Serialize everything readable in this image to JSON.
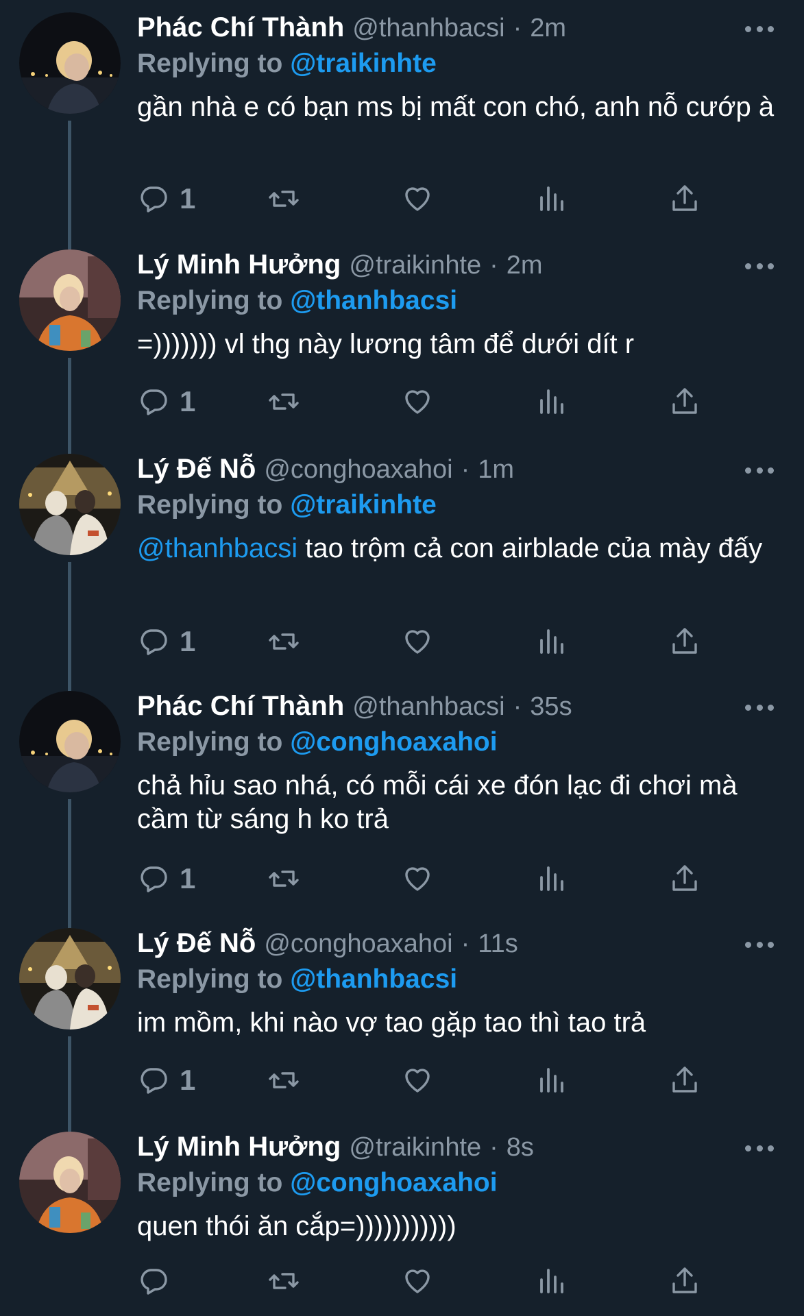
{
  "tweets": [
    {
      "name": "Phác Chí Thành",
      "handle": "@thanhbacsi",
      "time": "2m",
      "replying_prefix": "Replying to",
      "replying_to": "@traikinhte",
      "mention": "",
      "text": "gần nhà e có bạn ms bị mất con chó, anh nỗ cướp à",
      "reply_count": "1",
      "avatar": "avatar-a"
    },
    {
      "name": "Lý Minh Hưởng",
      "handle": "@traikinhte",
      "time": "2m",
      "replying_prefix": "Replying to",
      "replying_to": "@thanhbacsi",
      "mention": "",
      "text": "=))))))) vl thg này lương tâm để dưới dít r",
      "reply_count": "1",
      "avatar": "avatar-b"
    },
    {
      "name": "Lý Đế Nỗ",
      "handle": "@conghoaxahoi",
      "time": "1m",
      "replying_prefix": "Replying to",
      "replying_to": "@traikinhte",
      "mention": "@thanhbacsi",
      "text": " tao trộm cả con airblade của mày đấy",
      "reply_count": "1",
      "avatar": "avatar-c"
    },
    {
      "name": "Phác Chí Thành",
      "handle": "@thanhbacsi",
      "time": "35s",
      "replying_prefix": "Replying to",
      "replying_to": "@conghoaxahoi",
      "mention": "",
      "text": "chả hỉu sao nhá, có mỗi cái xe đón lạc đi chơi mà cầm từ sáng h ko trả",
      "reply_count": "1",
      "avatar": "avatar-a"
    },
    {
      "name": "Lý Đế Nỗ",
      "handle": "@conghoaxahoi",
      "time": "11s",
      "replying_prefix": "Replying to",
      "replying_to": "@thanhbacsi",
      "mention": "",
      "text": "im mồm, khi nào vợ tao gặp tao thì tao trả",
      "reply_count": "1",
      "avatar": "avatar-c"
    },
    {
      "name": "Lý Minh Hưởng",
      "handle": "@traikinhte",
      "time": "8s",
      "replying_prefix": "Replying to",
      "replying_to": "@conghoaxahoi",
      "mention": "",
      "text": "quen thói ăn cắp=)))))))))))",
      "reply_count": "",
      "avatar": "avatar-b"
    }
  ],
  "icons": {
    "reply": "reply-icon",
    "retweet": "retweet-icon",
    "like": "heart-icon",
    "stats": "stats-icon",
    "share": "share-icon",
    "more": "more-icon"
  },
  "colors": {
    "background": "#15202b",
    "accent": "#1d9bf0",
    "muted": "#8b98a5",
    "thread_line": "#3d5466"
  }
}
